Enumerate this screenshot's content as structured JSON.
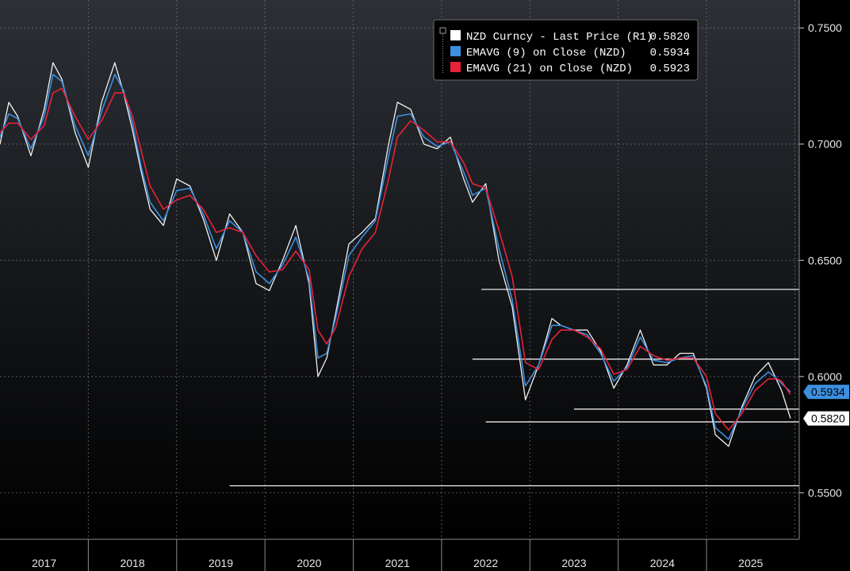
{
  "chart_data": {
    "type": "line",
    "ylim": [
      0.53,
      0.762
    ],
    "xlim": [
      2016.5,
      2025.55
    ],
    "y_axis_position": "right",
    "grid": true,
    "legend_position": "top-center",
    "y_ticks": [
      "0.7500",
      "0.7000",
      "0.6500",
      "0.6000",
      "0.5500"
    ],
    "y_tick_values": [
      0.75,
      0.7,
      0.65,
      0.6,
      0.55
    ],
    "x_ticks": [
      "2017",
      "2018",
      "2019",
      "2020",
      "2021",
      "2022",
      "2023",
      "2024",
      "2025"
    ],
    "legend": [
      {
        "color": "#ffffff",
        "label": "NZD Curncy - Last Price (R1)",
        "value": "0.5820"
      },
      {
        "color": "#3d8fe0",
        "label": "EMAVG (9)  on Close (NZD)",
        "value": "0.5934"
      },
      {
        "color": "#e8223a",
        "label": "EMAVG (21)  on Close (NZD)",
        "value": "0.5923"
      }
    ],
    "last_value_tags": [
      {
        "label": "0.5934",
        "value": 0.5934,
        "color": "#3d8fe0"
      },
      {
        "label": "0.5820",
        "value": 0.582,
        "color": "#ffffff"
      }
    ],
    "horizontal_levels": [
      {
        "value": 0.6375,
        "x_start": 2021.95
      },
      {
        "value": 0.6075,
        "x_start": 2021.85
      },
      {
        "value": 0.586,
        "x_start": 2023.0
      },
      {
        "value": 0.5805,
        "x_start": 2022.0
      },
      {
        "value": 0.553,
        "x_start": 2019.1
      }
    ],
    "series": [
      {
        "name": "NZD Curncy - Last Price (R1)",
        "x": [
          2016.5,
          2016.6,
          2016.7,
          2016.85,
          2017.0,
          2017.1,
          2017.2,
          2017.35,
          2017.5,
          2017.65,
          2017.8,
          2017.9,
          2018.0,
          2018.1,
          2018.2,
          2018.35,
          2018.5,
          2018.65,
          2018.8,
          2018.95,
          2019.1,
          2019.25,
          2019.4,
          2019.55,
          2019.7,
          2019.85,
          2020.0,
          2020.1,
          2020.2,
          2020.3,
          2020.45,
          2020.6,
          2020.75,
          2020.9,
          2021.0,
          2021.15,
          2021.3,
          2021.45,
          2021.6,
          2021.75,
          2021.85,
          2022.0,
          2022.15,
          2022.3,
          2022.45,
          2022.6,
          2022.75,
          2022.85,
          2023.0,
          2023.15,
          2023.3,
          2023.45,
          2023.6,
          2023.75,
          2023.9,
          2024.05,
          2024.2,
          2024.35,
          2024.5,
          2024.6,
          2024.75,
          2024.9,
          2025.05,
          2025.2,
          2025.3,
          2025.35,
          2025.45
        ],
        "y": [
          0.7,
          0.718,
          0.712,
          0.695,
          0.715,
          0.735,
          0.728,
          0.705,
          0.69,
          0.718,
          0.735,
          0.722,
          0.706,
          0.688,
          0.672,
          0.665,
          0.685,
          0.682,
          0.668,
          0.65,
          0.67,
          0.662,
          0.64,
          0.637,
          0.65,
          0.665,
          0.64,
          0.6,
          0.608,
          0.627,
          0.657,
          0.662,
          0.668,
          0.7,
          0.718,
          0.715,
          0.7,
          0.698,
          0.703,
          0.685,
          0.675,
          0.683,
          0.65,
          0.63,
          0.59,
          0.605,
          0.625,
          0.622,
          0.62,
          0.62,
          0.611,
          0.595,
          0.605,
          0.62,
          0.605,
          0.605,
          0.61,
          0.61,
          0.595,
          0.575,
          0.57,
          0.587,
          0.6,
          0.606,
          0.598,
          0.594,
          0.582
        ]
      },
      {
        "name": "EMAVG (9)  on Close (NZD)",
        "x": [
          2016.5,
          2016.6,
          2016.7,
          2016.85,
          2017.0,
          2017.1,
          2017.2,
          2017.35,
          2017.5,
          2017.65,
          2017.8,
          2017.9,
          2018.0,
          2018.1,
          2018.2,
          2018.35,
          2018.5,
          2018.65,
          2018.8,
          2018.95,
          2019.1,
          2019.25,
          2019.4,
          2019.55,
          2019.7,
          2019.85,
          2020.0,
          2020.1,
          2020.2,
          2020.3,
          2020.45,
          2020.6,
          2020.75,
          2020.9,
          2021.0,
          2021.15,
          2021.3,
          2021.45,
          2021.6,
          2021.75,
          2021.85,
          2022.0,
          2022.15,
          2022.3,
          2022.45,
          2022.6,
          2022.75,
          2022.85,
          2023.0,
          2023.15,
          2023.3,
          2023.45,
          2023.6,
          2023.75,
          2023.9,
          2024.05,
          2024.2,
          2024.35,
          2024.5,
          2024.6,
          2024.75,
          2024.9,
          2025.05,
          2025.2,
          2025.3,
          2025.35,
          2025.45
        ],
        "y": [
          0.703,
          0.713,
          0.711,
          0.698,
          0.712,
          0.73,
          0.727,
          0.708,
          0.695,
          0.714,
          0.73,
          0.723,
          0.709,
          0.69,
          0.675,
          0.667,
          0.68,
          0.681,
          0.67,
          0.655,
          0.667,
          0.662,
          0.645,
          0.64,
          0.648,
          0.66,
          0.642,
          0.608,
          0.61,
          0.625,
          0.652,
          0.66,
          0.667,
          0.695,
          0.712,
          0.713,
          0.703,
          0.699,
          0.701,
          0.688,
          0.678,
          0.681,
          0.655,
          0.633,
          0.596,
          0.605,
          0.622,
          0.622,
          0.62,
          0.618,
          0.61,
          0.598,
          0.604,
          0.617,
          0.607,
          0.606,
          0.608,
          0.609,
          0.596,
          0.578,
          0.573,
          0.586,
          0.597,
          0.602,
          0.599,
          0.597,
          0.5934
        ]
      },
      {
        "name": "EMAVG (21)  on Close (NZD)",
        "x": [
          2016.5,
          2016.6,
          2016.7,
          2016.85,
          2017.0,
          2017.1,
          2017.2,
          2017.35,
          2017.5,
          2017.65,
          2017.8,
          2017.9,
          2018.0,
          2018.1,
          2018.2,
          2018.35,
          2018.5,
          2018.65,
          2018.8,
          2018.95,
          2019.1,
          2019.25,
          2019.4,
          2019.55,
          2019.7,
          2019.85,
          2020.0,
          2020.1,
          2020.2,
          2020.3,
          2020.45,
          2020.6,
          2020.75,
          2020.9,
          2021.0,
          2021.15,
          2021.3,
          2021.45,
          2021.6,
          2021.75,
          2021.85,
          2022.0,
          2022.15,
          2022.3,
          2022.45,
          2022.6,
          2022.75,
          2022.85,
          2023.0,
          2023.15,
          2023.3,
          2023.45,
          2023.6,
          2023.75,
          2023.9,
          2024.05,
          2024.2,
          2024.35,
          2024.5,
          2024.6,
          2024.75,
          2024.9,
          2025.05,
          2025.2,
          2025.3,
          2025.35,
          2025.45
        ],
        "y": [
          0.705,
          0.709,
          0.709,
          0.702,
          0.708,
          0.722,
          0.724,
          0.712,
          0.702,
          0.71,
          0.722,
          0.722,
          0.712,
          0.697,
          0.682,
          0.672,
          0.676,
          0.678,
          0.672,
          0.662,
          0.664,
          0.662,
          0.652,
          0.645,
          0.646,
          0.654,
          0.646,
          0.62,
          0.614,
          0.621,
          0.643,
          0.655,
          0.662,
          0.685,
          0.703,
          0.71,
          0.706,
          0.701,
          0.701,
          0.692,
          0.683,
          0.681,
          0.663,
          0.643,
          0.606,
          0.603,
          0.616,
          0.62,
          0.62,
          0.617,
          0.612,
          0.601,
          0.603,
          0.613,
          0.609,
          0.607,
          0.608,
          0.608,
          0.6,
          0.584,
          0.577,
          0.584,
          0.594,
          0.599,
          0.599,
          0.598,
          0.5923
        ]
      }
    ]
  }
}
